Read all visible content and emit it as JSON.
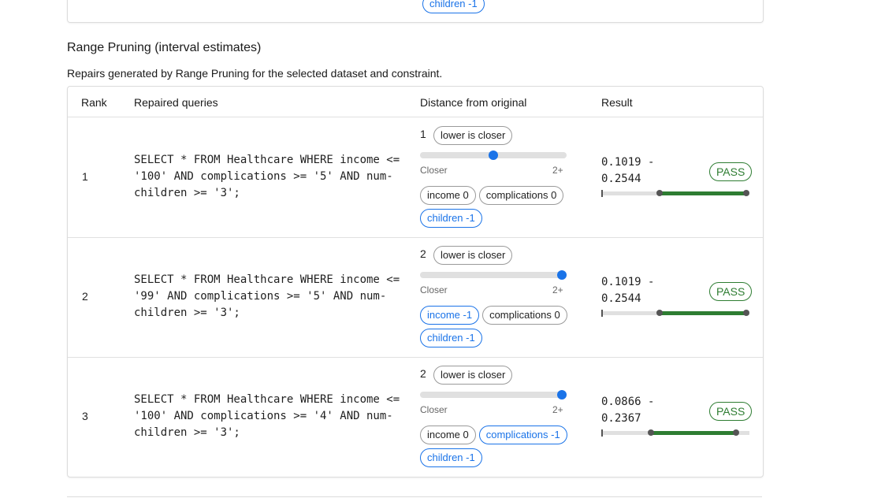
{
  "previous_card": {
    "chip": "children -1"
  },
  "section": {
    "title": "Range Pruning (interval estimates)",
    "description": "Repairs generated by Range Pruning for the selected dataset and constraint."
  },
  "table": {
    "headers": {
      "rank": "Rank",
      "queries": "Repaired queries",
      "distance": "Distance from original",
      "result": "Result"
    },
    "distance_hint": "lower is closer",
    "slider_min_label": "Closer",
    "slider_max_label": "2+",
    "rows": [
      {
        "rank": "1",
        "query": "SELECT * FROM Healthcare WHERE income <= '100' AND complications >= '5' AND num-children >= '3';",
        "distance": "1",
        "slider_level": 0.5,
        "chips": [
          {
            "label": "income 0",
            "changed": false
          },
          {
            "label": "complications 0",
            "changed": false
          },
          {
            "label": "children -1",
            "changed": true
          }
        ],
        "result_low": "0.1019 -",
        "result_high": "0.2544",
        "status": "PASS",
        "range_low": 0.1019,
        "range_high": 0.2544
      },
      {
        "rank": "2",
        "query": "SELECT * FROM Healthcare WHERE income <= '99' AND complications >= '5' AND num-children >= '3';",
        "distance": "2",
        "slider_level": 1.0,
        "chips": [
          {
            "label": "income -1",
            "changed": true
          },
          {
            "label": "complications 0",
            "changed": false
          },
          {
            "label": "children -1",
            "changed": true
          }
        ],
        "result_low": "0.1019 -",
        "result_high": "0.2544",
        "status": "PASS",
        "range_low": 0.1019,
        "range_high": 0.2544
      },
      {
        "rank": "3",
        "query": "SELECT * FROM Healthcare WHERE income <= '100' AND complications >= '4' AND num-children >= '3';",
        "distance": "2",
        "slider_level": 1.0,
        "chips": [
          {
            "label": "income 0",
            "changed": false
          },
          {
            "label": "complications -1",
            "changed": true
          },
          {
            "label": "children -1",
            "changed": true
          }
        ],
        "result_low": "0.0866 -",
        "result_high": "0.2367",
        "status": "PASS",
        "range_low": 0.0866,
        "range_high": 0.2367
      }
    ]
  },
  "colors": {
    "accent": "#1a73e8",
    "pass": "#2e7d32",
    "track": "#e0e0e0"
  }
}
